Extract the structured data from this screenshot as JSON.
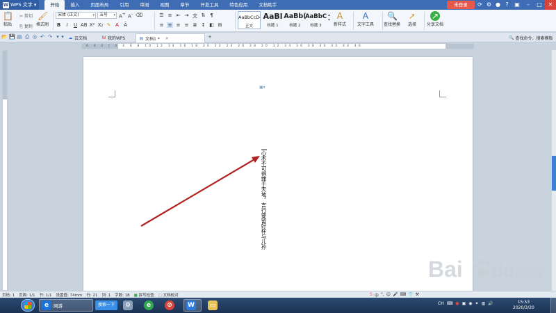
{
  "titlebar": {
    "app_name": "WPS 文字",
    "menu_tabs": [
      "开始",
      "插入",
      "页面布局",
      "引用",
      "审阅",
      "视图",
      "章节",
      "开发工具",
      "特色应用",
      "文档助手"
    ],
    "login_label": "未登录"
  },
  "ribbon": {
    "paste": "粘贴",
    "cut": "剪切",
    "copy": "复制",
    "format_painter": "格式刷",
    "font_name": "宋体 (正文)",
    "font_size": "五号",
    "styles": [
      {
        "sample": "AaBbCcDd",
        "name": "正文"
      },
      {
        "sample": "AaBl",
        "name": "标题 1"
      },
      {
        "sample": "AaBb(",
        "name": "标题 2"
      },
      {
        "sample": "AaBbC",
        "name": "标题 3"
      }
    ],
    "new_style": "新样式",
    "text_tools": "文字工具",
    "find_replace": "查找替换",
    "select": "选择",
    "share_doc": "分享文档"
  },
  "tabbar": {
    "doc_tabs": [
      {
        "label": "云文档"
      },
      {
        "label": "我的WPS"
      },
      {
        "label": "文档1 *"
      }
    ],
    "command_search": "查找命令、搜索模板"
  },
  "ruler": {
    "h_numbers": "6 4 2 | 2 4 6 8 10 12 14 16 18 20 22 24 26 28 30 32 34 36 38 40 42 44 46"
  },
  "document": {
    "vertical_text": "心术不可得罪于天地，言行要留好样与儿孙"
  },
  "statusbar": {
    "items": [
      "页码: 1",
      "页面: 1/1",
      "节: 1/1",
      "设置值: 74mm",
      "行: 21",
      "列: 1",
      "字数: 18",
      "拼写检查",
      "文档校对"
    ]
  },
  "taskbar": {
    "browser_label": "网游",
    "search_label": "搜索一下",
    "tray_lang": "CH",
    "clock_time": "15:53",
    "clock_date": "2020/3/20"
  },
  "watermark": {
    "brand": "Baidu",
    "cn": "经验"
  },
  "colors": {
    "title_blue": "#3e6db5",
    "login_red": "#e8584b",
    "arrow_red": "#b22222"
  }
}
